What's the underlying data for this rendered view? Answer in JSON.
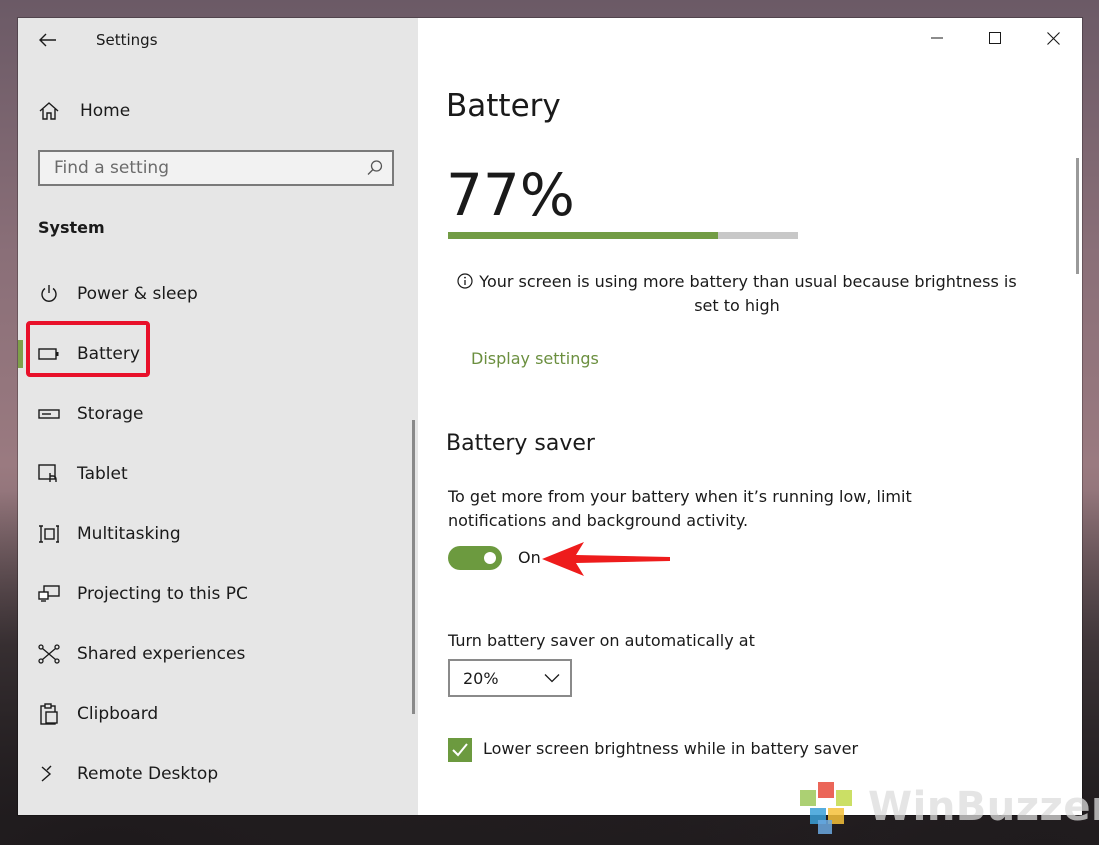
{
  "window": {
    "title": "Settings"
  },
  "sidebar": {
    "home_label": "Home",
    "search_placeholder": "Find a setting",
    "section": "System",
    "items": [
      {
        "label": "Power & sleep",
        "icon": "power-icon"
      },
      {
        "label": "Battery",
        "icon": "battery-icon",
        "active": true
      },
      {
        "label": "Storage",
        "icon": "storage-icon"
      },
      {
        "label": "Tablet",
        "icon": "tablet-icon"
      },
      {
        "label": "Multitasking",
        "icon": "multitasking-icon"
      },
      {
        "label": "Projecting to this PC",
        "icon": "projecting-icon"
      },
      {
        "label": "Shared experiences",
        "icon": "shared-experiences-icon"
      },
      {
        "label": "Clipboard",
        "icon": "clipboard-icon"
      },
      {
        "label": "Remote Desktop",
        "icon": "remote-desktop-icon"
      }
    ]
  },
  "main": {
    "title": "Battery",
    "percent_text": "77%",
    "battery_level": 0.77,
    "info_message": "Your screen is using more battery than usual because brightness is set to high",
    "display_settings_link": "Display settings",
    "battery_saver": {
      "heading": "Battery saver",
      "description": "To get more from your battery when it’s running low, limit notifications and background activity.",
      "toggle_state": "On",
      "auto_label": "Turn battery saver on automatically at",
      "threshold": "20%",
      "lower_brightness_label": "Lower screen brightness while in battery saver",
      "lower_brightness_checked": true
    }
  },
  "watermark": {
    "text": "WinBuzzer"
  },
  "colors": {
    "accent": "#729c45",
    "annotation": "#e8102a",
    "sidebar_bg": "#e6e6e6"
  }
}
